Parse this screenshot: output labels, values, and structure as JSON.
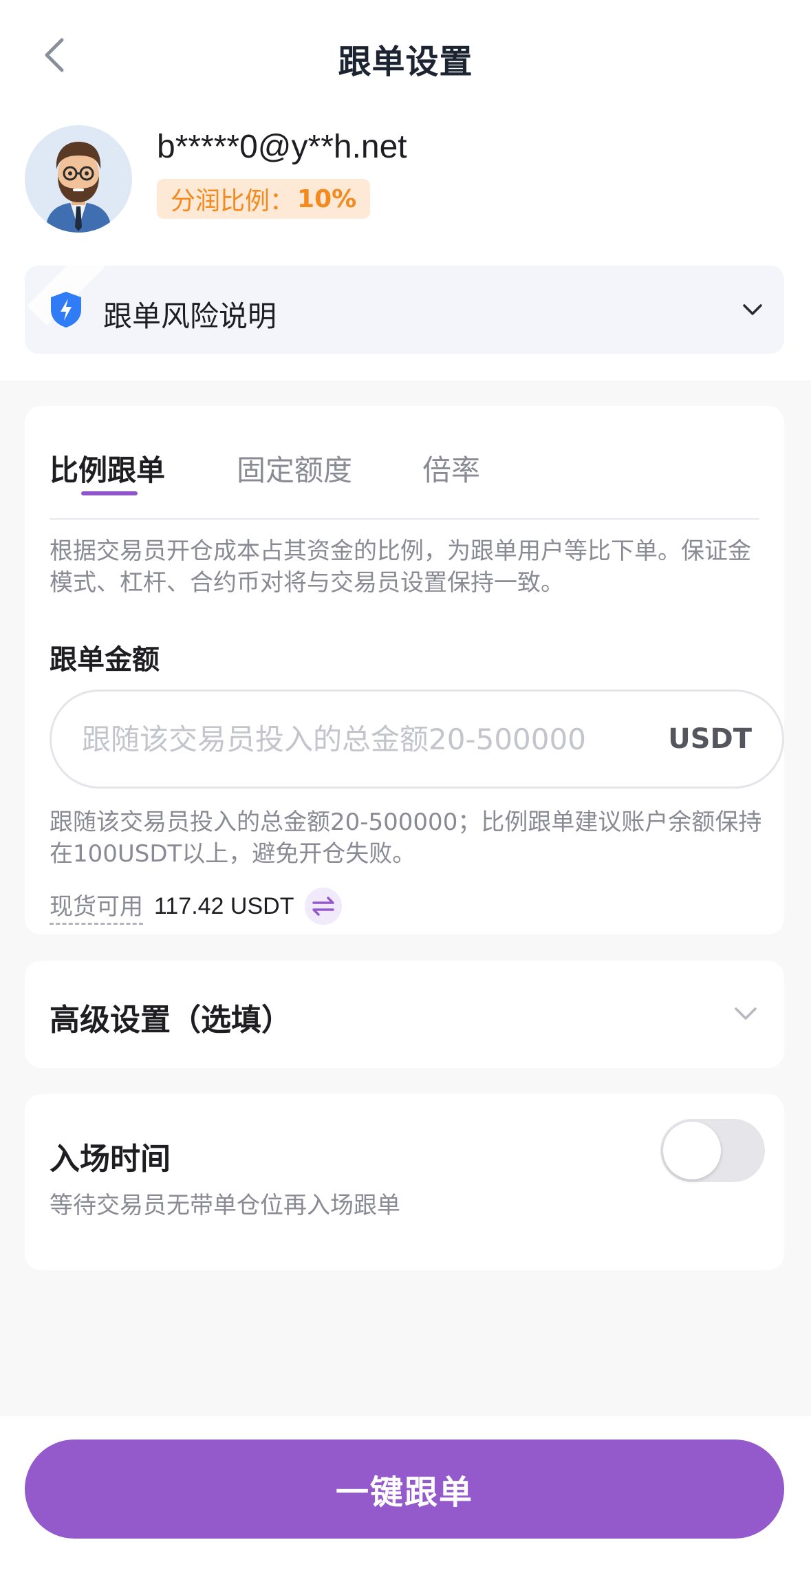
{
  "header": {
    "title": "跟单设置"
  },
  "trader": {
    "email": "b*****0@y**h.net",
    "share_label": "分润比例：",
    "share_value": "10%"
  },
  "risk": {
    "label": "跟单风险说明"
  },
  "tabs": [
    {
      "label": "比例跟单",
      "active": true
    },
    {
      "label": "固定额度",
      "active": false
    },
    {
      "label": "倍率",
      "active": false
    }
  ],
  "mode_description": "根据交易员开仓成本占其资金的比例，为跟单用户等比下单。保证金模式、杠杆、合约币对将与交易员设置保持一致。",
  "amount": {
    "label": "跟单金额",
    "placeholder": "跟随该交易员投入的总金额20-500000",
    "value": "",
    "unit": "USDT",
    "hint": "跟随该交易员投入的总金额20-500000；比例跟单建议账户余额保持在100USDT以上，避免开仓失败。"
  },
  "available": {
    "label": "现货可用",
    "value": "117.42 USDT"
  },
  "advanced": {
    "title": "高级设置（选填）"
  },
  "entry_time": {
    "title": "入场时间",
    "subtitle": "等待交易员无带单仓位再入场跟单",
    "enabled": false
  },
  "cta": {
    "label": "一键跟单"
  },
  "colors": {
    "accent": "#945acb",
    "badge_text": "#f28a1f",
    "badge_bg": "#fde9d6",
    "shield": "#2f7cf6"
  }
}
